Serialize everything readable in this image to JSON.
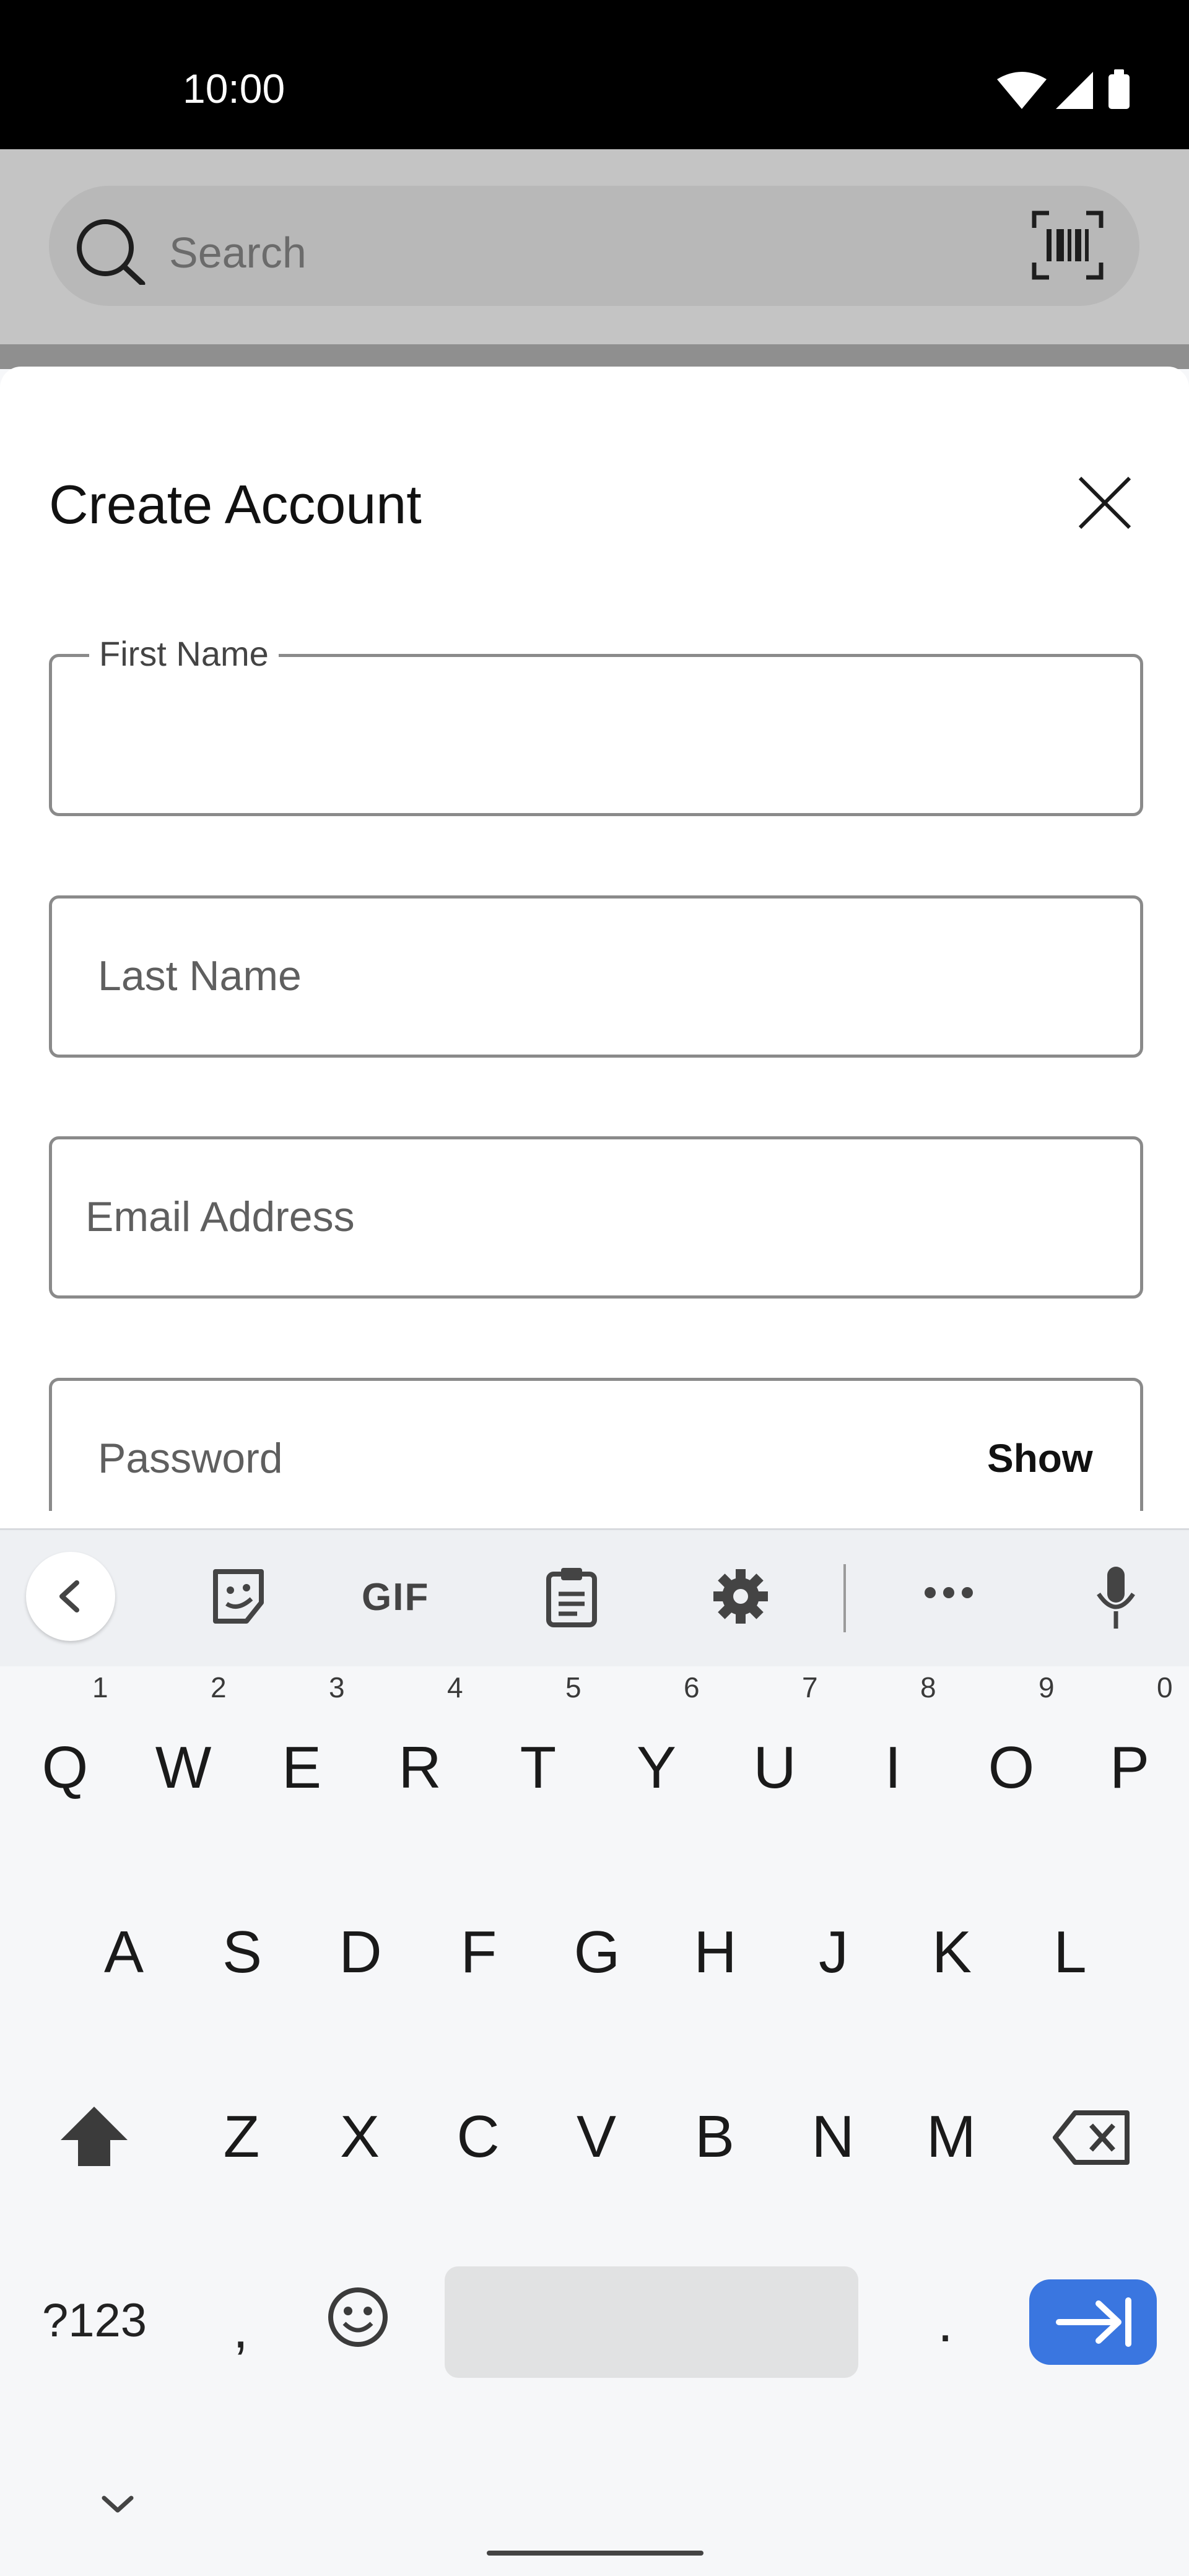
{
  "status_bar": {
    "time": "10:00"
  },
  "search_bar": {
    "placeholder": "Search"
  },
  "dialog": {
    "title": "Create Account",
    "fields": {
      "first_name": {
        "label": "First Name",
        "value": ""
      },
      "last_name": {
        "placeholder": "Last Name"
      },
      "email": {
        "placeholder": "Email Address"
      },
      "password": {
        "placeholder": "Password",
        "toggle_label": "Show"
      }
    }
  },
  "keyboard": {
    "toolbar": {
      "gif_label": "GIF"
    },
    "row1": [
      "Q",
      "W",
      "E",
      "R",
      "T",
      "Y",
      "U",
      "I",
      "O",
      "P"
    ],
    "row1_numbers": [
      "1",
      "2",
      "3",
      "4",
      "5",
      "6",
      "7",
      "8",
      "9",
      "0"
    ],
    "row2": [
      "A",
      "S",
      "D",
      "F",
      "G",
      "H",
      "J",
      "K",
      "L"
    ],
    "row3": [
      "Z",
      "X",
      "C",
      "V",
      "B",
      "N",
      "M"
    ],
    "symbols_key": "?123",
    "comma_key": ",",
    "period_key": "."
  },
  "colors": {
    "accent": "#3a76e0",
    "sheet_bg": "#ffffff",
    "keyboard_bg": "#f6f7f9"
  },
  "icons": [
    "search-icon",
    "barcode-scan-icon",
    "close-icon",
    "back-chevron-icon",
    "sticker-icon",
    "clipboard-icon",
    "gear-icon",
    "more-icon",
    "mic-icon",
    "shift-icon",
    "backspace-icon",
    "emoji-icon",
    "tab-next-icon",
    "hide-keyboard-icon"
  ]
}
